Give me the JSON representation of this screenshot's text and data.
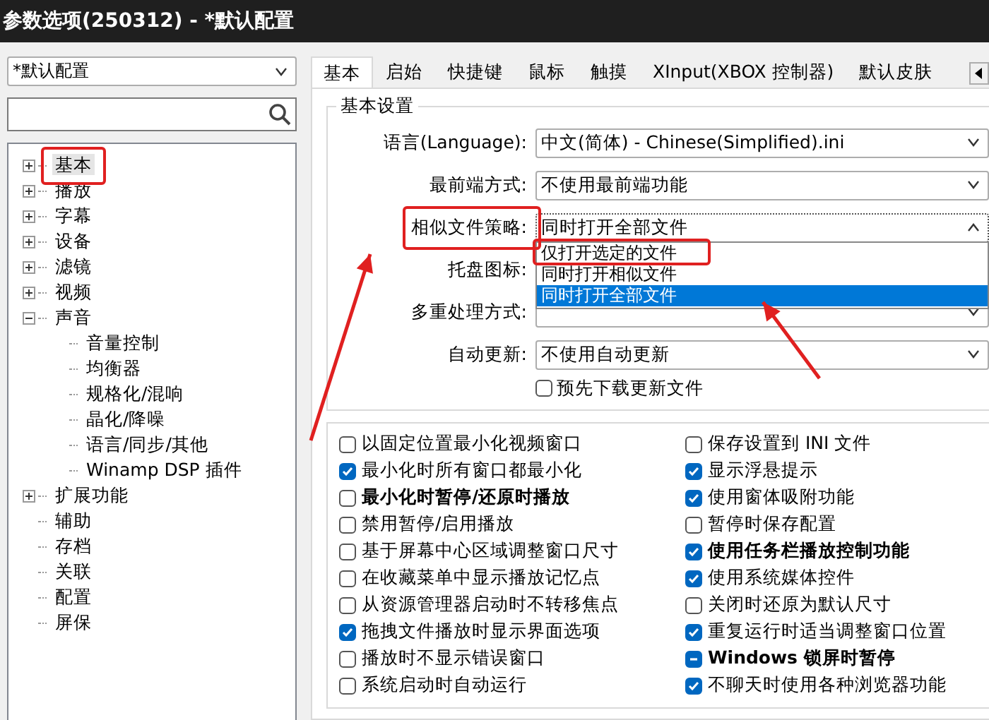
{
  "window": {
    "title": "参数选项(250312) - *默认配置"
  },
  "sidebar": {
    "profile": "*默认配置",
    "tree": [
      {
        "label": "基本",
        "kind": "branch",
        "expanded": false,
        "selected": true
      },
      {
        "label": "播放",
        "kind": "branch",
        "expanded": false,
        "selected": false
      },
      {
        "label": "字幕",
        "kind": "branch",
        "expanded": false,
        "selected": false
      },
      {
        "label": "设备",
        "kind": "branch",
        "expanded": false,
        "selected": false
      },
      {
        "label": "滤镜",
        "kind": "branch",
        "expanded": false,
        "selected": false
      },
      {
        "label": "视频",
        "kind": "branch",
        "expanded": false,
        "selected": false
      },
      {
        "label": "声音",
        "kind": "branch",
        "expanded": true,
        "selected": false,
        "children": [
          {
            "label": "音量控制",
            "kind": "leaf",
            "selected": false
          },
          {
            "label": "均衡器",
            "kind": "leaf",
            "selected": false
          },
          {
            "label": "规格化/混响",
            "kind": "leaf",
            "selected": false
          },
          {
            "label": "晶化/降噪",
            "kind": "leaf",
            "selected": false
          },
          {
            "label": "语言/同步/其他",
            "kind": "leaf",
            "selected": false
          },
          {
            "label": "Winamp DSP 插件",
            "kind": "leaf",
            "selected": false
          }
        ]
      },
      {
        "label": "扩展功能",
        "kind": "branch",
        "expanded": false,
        "selected": false
      },
      {
        "label": "辅助",
        "kind": "leaf",
        "selected": false
      },
      {
        "label": "存档",
        "kind": "leaf",
        "selected": false
      },
      {
        "label": "关联",
        "kind": "leaf",
        "selected": false
      },
      {
        "label": "配置",
        "kind": "leaf",
        "selected": false
      },
      {
        "label": "屏保",
        "kind": "leaf",
        "selected": false
      }
    ]
  },
  "tabs": [
    {
      "label": "基本",
      "selected": true
    },
    {
      "label": "启始",
      "selected": false
    },
    {
      "label": "快捷键",
      "selected": false
    },
    {
      "label": "鼠标",
      "selected": false
    },
    {
      "label": "触摸",
      "selected": false
    },
    {
      "label": "XInput(XBOX 控制器)",
      "selected": false
    },
    {
      "label": "默认皮肤",
      "selected": false
    }
  ],
  "settings": {
    "title": "基本设置",
    "fields": [
      {
        "label": "语言(Language):",
        "value": "中文(简体) - Chinese(Simplified).ini",
        "open": false
      },
      {
        "label": "最前端方式:",
        "value": "不使用最前端功能",
        "open": false
      },
      {
        "label": "相似文件策略:",
        "value": "同时打开全部文件",
        "open": true,
        "options": [
          {
            "label": "仅打开选定的文件",
            "selected": false
          },
          {
            "label": "同时打开相似文件",
            "selected": false
          },
          {
            "label": "同时打开全部文件",
            "selected": true
          }
        ]
      },
      {
        "label": "托盘图标:"
      },
      {
        "label": "多重处理方式:",
        "open": false
      },
      {
        "label": "自动更新:",
        "value": "不使用自动更新",
        "open": false
      }
    ],
    "prefetch": {
      "label": "预先下载更新文件",
      "checked": false
    }
  },
  "options": [
    {
      "label": "以固定位置最小化视频窗口",
      "checked": false,
      "indeterminate": false,
      "bold": false
    },
    {
      "label": "保存设置到 INI 文件",
      "checked": false,
      "indeterminate": false,
      "bold": false
    },
    {
      "label": "最小化时所有窗口都最小化",
      "checked": true,
      "indeterminate": false,
      "bold": false
    },
    {
      "label": "显示浮悬提示",
      "checked": true,
      "indeterminate": false,
      "bold": false
    },
    {
      "label": "最小化时暂停/还原时播放",
      "checked": false,
      "indeterminate": false,
      "bold": true
    },
    {
      "label": "使用窗体吸附功能",
      "checked": true,
      "indeterminate": false,
      "bold": false
    },
    {
      "label": "禁用暂停/启用播放",
      "checked": false,
      "indeterminate": false,
      "bold": false
    },
    {
      "label": "暂停时保存配置",
      "checked": false,
      "indeterminate": false,
      "bold": false
    },
    {
      "label": "基于屏幕中心区域调整窗口尺寸",
      "checked": false,
      "indeterminate": false,
      "bold": false
    },
    {
      "label": "使用任务栏播放控制功能",
      "checked": true,
      "indeterminate": false,
      "bold": true
    },
    {
      "label": "在收藏菜单中显示播放记忆点",
      "checked": false,
      "indeterminate": false,
      "bold": false
    },
    {
      "label": "使用系统媒体控件",
      "checked": true,
      "indeterminate": false,
      "bold": false
    },
    {
      "label": "从资源管理器启动时不转移焦点",
      "checked": false,
      "indeterminate": false,
      "bold": false
    },
    {
      "label": "关闭时还原为默认尺寸",
      "checked": false,
      "indeterminate": false,
      "bold": false
    },
    {
      "label": "拖拽文件播放时显示界面选项",
      "checked": true,
      "indeterminate": false,
      "bold": false
    },
    {
      "label": "重复运行时适当调整窗口位置",
      "checked": true,
      "indeterminate": false,
      "bold": false
    },
    {
      "label": "播放时不显示错误窗口",
      "checked": false,
      "indeterminate": false,
      "bold": false
    },
    {
      "label": "Windows 锁屏时暂停",
      "checked": false,
      "indeterminate": true,
      "bold": true
    },
    {
      "label": "系统启动时自动运行",
      "checked": false,
      "indeterminate": false,
      "bold": false
    },
    {
      "label": "不聊天时使用各种浏览器功能",
      "checked": true,
      "indeterminate": false,
      "bold": false
    }
  ]
}
